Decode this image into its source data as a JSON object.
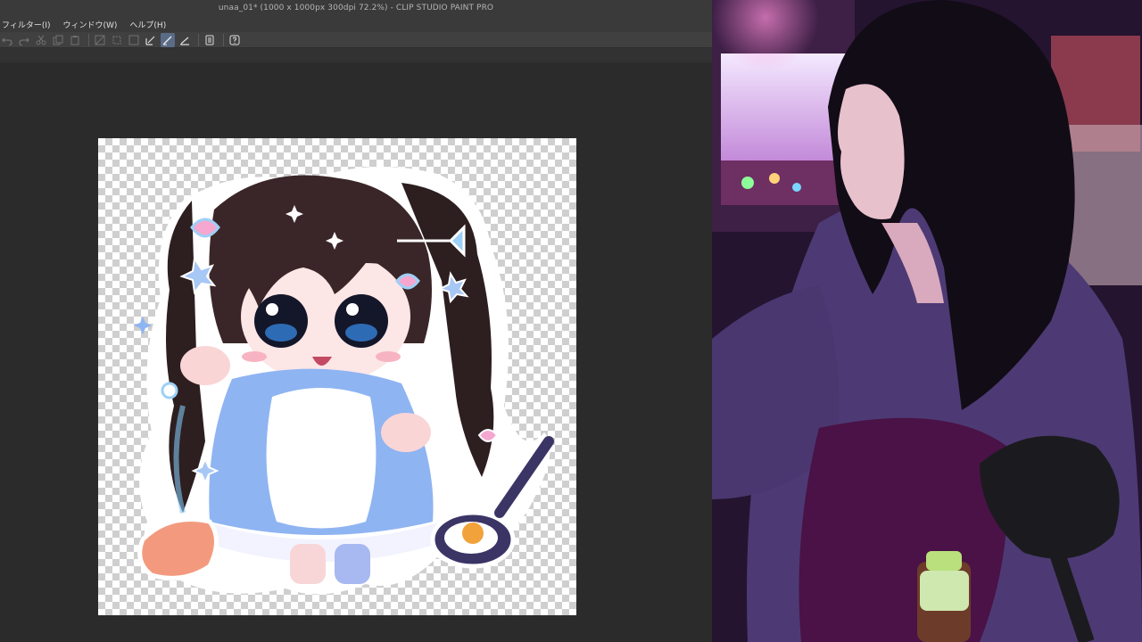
{
  "window": {
    "title": "unaa_01* (1000 x 1000px 300dpi 72.2%)  - CLIP STUDIO PAINT PRO"
  },
  "menu": {
    "items": [
      "フィルター(I)",
      "ウィンドウ(W)",
      "ヘルプ(H)"
    ]
  },
  "toolbar": {
    "icons": [
      "undo-icon",
      "redo-icon",
      "cut-icon",
      "copy-icon",
      "clear-icon",
      "transform-icon",
      "fill-icon",
      "pen-icon",
      "pen-active-icon",
      "ruler-icon",
      "layer-icon",
      "help-icon"
    ]
  },
  "colors": {
    "canvas_bg": "#2b2b2b",
    "titlebar": "#3a3a3a",
    "toolbar": "#404040",
    "active_tool": "#5a6b86"
  }
}
